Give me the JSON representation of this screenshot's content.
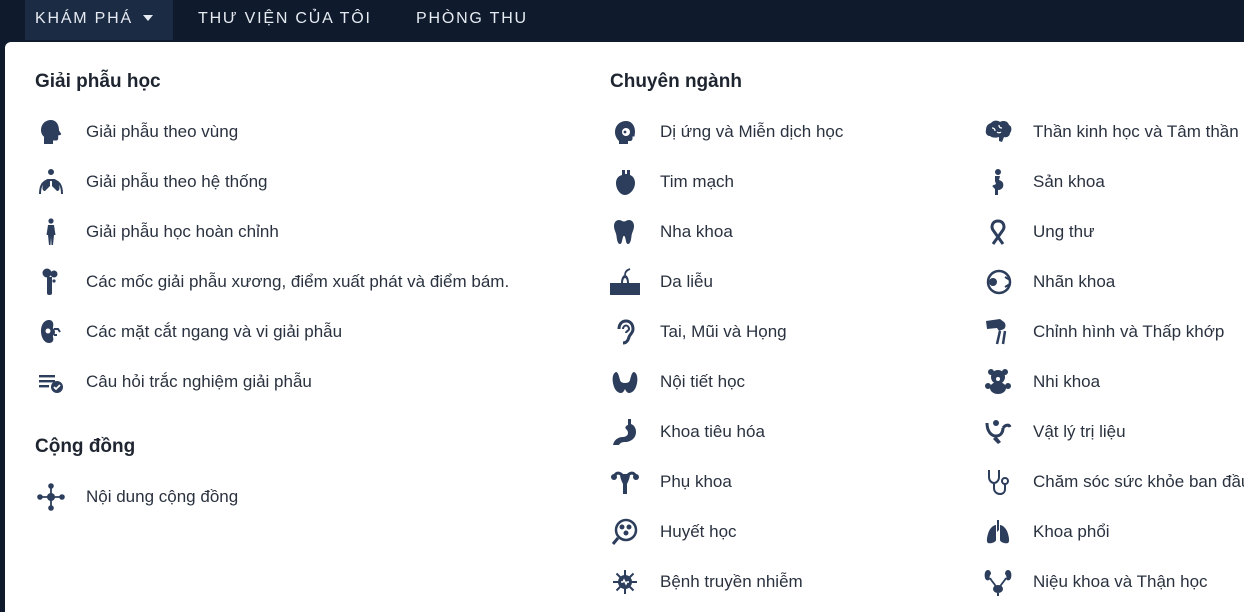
{
  "nav": {
    "explore": "KHÁM PHÁ",
    "library": "THƯ VIỆN CỦA TÔI",
    "studio": "PHÒNG THU"
  },
  "colors": {
    "topbar": "#0f1b2d",
    "active_tab": "#1c2b44",
    "icon": "#2c3e5c",
    "text": "#2a3240"
  },
  "anatomy": {
    "title": "Giải phẫu học",
    "items": [
      {
        "label": "Giải phẫu theo vùng",
        "icon": "head-icon"
      },
      {
        "label": "Giải phẫu theo hệ thống",
        "icon": "lungs-body-icon"
      },
      {
        "label": "Giải phẫu học hoàn chỉnh",
        "icon": "human-figure-icon"
      },
      {
        "label": "Các mốc giải phẫu xương, điểm xuất phát và điểm bám.",
        "icon": "bone-icon"
      },
      {
        "label": "Các mặt cắt ngang và vi giải phẫu",
        "icon": "kidney-icon"
      },
      {
        "label": "Câu hỏi trắc nghiệm giải phẫu",
        "icon": "quiz-list-icon"
      }
    ]
  },
  "community": {
    "title": "Cộng đồng",
    "items": [
      {
        "label": "Nội dung cộng đồng",
        "icon": "network-icon"
      }
    ]
  },
  "specialties": {
    "title": "Chuyên ngành",
    "col1": [
      {
        "label": "Dị ứng và Miễn dịch học",
        "icon": "allergy-icon"
      },
      {
        "label": "Tim mạch",
        "icon": "heart-icon"
      },
      {
        "label": "Nha khoa",
        "icon": "tooth-icon"
      },
      {
        "label": "Da liễu",
        "icon": "skin-icon"
      },
      {
        "label": "Tai, Mũi và Họng",
        "icon": "ear-icon"
      },
      {
        "label": "Nội tiết học",
        "icon": "thyroid-icon"
      },
      {
        "label": "Khoa tiêu hóa",
        "icon": "stomach-icon"
      },
      {
        "label": "Phụ khoa",
        "icon": "uterus-icon"
      },
      {
        "label": "Huyết học",
        "icon": "blood-cells-icon"
      },
      {
        "label": "Bệnh truyền nhiễm",
        "icon": "virus-icon"
      }
    ],
    "col2": [
      {
        "label": "Thần kinh học và Tâm thần học",
        "icon": "brain-icon"
      },
      {
        "label": "Sản khoa",
        "icon": "pregnancy-icon"
      },
      {
        "label": "Ung thư",
        "icon": "ribbon-icon"
      },
      {
        "label": "Nhãn khoa",
        "icon": "eye-icon"
      },
      {
        "label": "Chỉnh hình và Thấp khớp",
        "icon": "knee-joint-icon"
      },
      {
        "label": "Nhi khoa",
        "icon": "teddy-bear-icon"
      },
      {
        "label": "Vật lý trị liệu",
        "icon": "physiotherapy-icon"
      },
      {
        "label": "Chăm sóc sức khỏe ban đầu",
        "icon": "stethoscope-icon"
      },
      {
        "label": "Khoa phổi",
        "icon": "lungs-icon"
      },
      {
        "label": "Niệu khoa và Thận học",
        "icon": "urinary-icon"
      }
    ]
  }
}
